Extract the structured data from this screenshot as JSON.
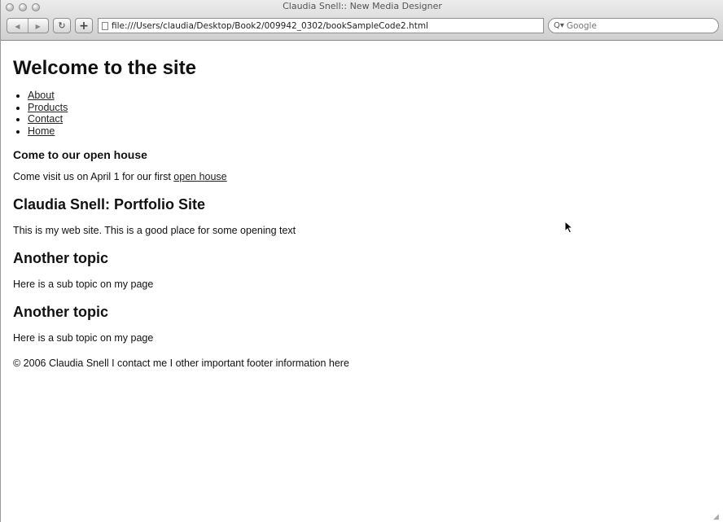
{
  "window": {
    "title": "Claudia Snell:: New Media Designer"
  },
  "toolbar": {
    "back_glyph": "◀",
    "forward_glyph": "▶",
    "reload_glyph": "↻",
    "add_glyph": "+"
  },
  "address_bar": {
    "url": "file:///Users/claudia/Desktop/Book2/009942_0302/bookSampleCode2.html"
  },
  "search": {
    "placeholder": "Google",
    "icon_glyph": "Q"
  },
  "page": {
    "heading": "Welcome to the site",
    "nav": [
      {
        "label": "About"
      },
      {
        "label": "Products"
      },
      {
        "label": "Contact"
      },
      {
        "label": "Home"
      }
    ],
    "open_house": {
      "heading": "Come to our open house",
      "text": "Come visit us on April 1 for our first ",
      "link": "open house"
    },
    "sections": [
      {
        "heading": "Claudia Snell: Portfolio Site",
        "text": "This is my web site. This is a good place for some opening text"
      },
      {
        "heading": "Another topic",
        "text": "Here is a sub topic on my page"
      },
      {
        "heading": "Another topic",
        "text": "Here is a sub topic on my page"
      }
    ],
    "footer": "© 2006 Claudia Snell I contact me I other important footer information here"
  },
  "icons": [
    "traffic-light-icon",
    "back-arrow-icon",
    "forward-arrow-icon",
    "reload-icon",
    "add-bookmark-icon",
    "page-icon",
    "search-icon",
    "mouse-pointer-icon",
    "resize-grip-icon"
  ]
}
